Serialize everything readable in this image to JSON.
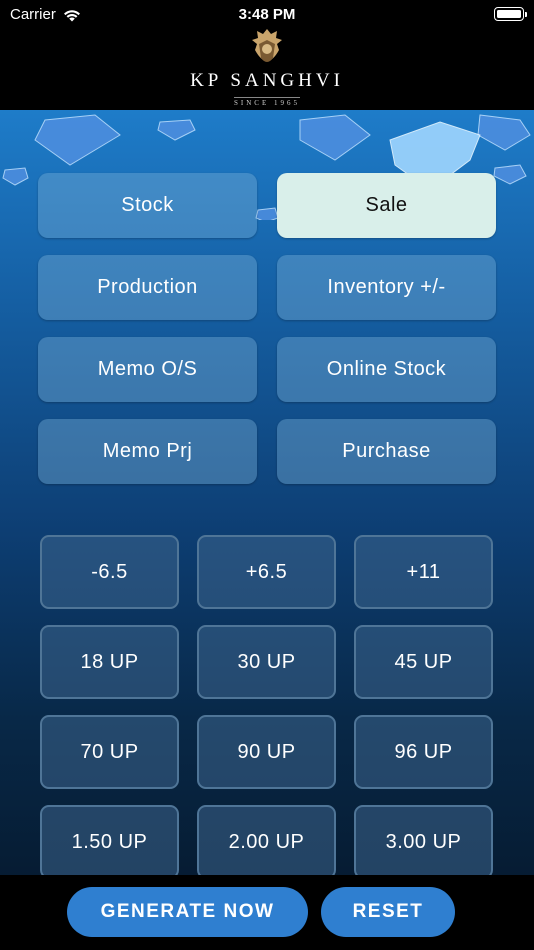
{
  "status_bar": {
    "carrier": "Carrier",
    "time": "3:48 PM"
  },
  "brand": {
    "name": "KP SANGHVI",
    "since": "SINCE 1965"
  },
  "nav_buttons": [
    {
      "label": "Stock",
      "active": false
    },
    {
      "label": "Sale",
      "active": true
    },
    {
      "label": "Production",
      "active": false
    },
    {
      "label": "Inventory +/-",
      "active": false
    },
    {
      "label": "Memo O/S",
      "active": false
    },
    {
      "label": "Online Stock",
      "active": false
    },
    {
      "label": "Memo Prj",
      "active": false
    },
    {
      "label": "Purchase",
      "active": false
    }
  ],
  "filter_chips": [
    "-6.5",
    "+6.5",
    "+11",
    "18 UP",
    "30 UP",
    "45 UP",
    "70 UP",
    "90 UP",
    "96 UP",
    "1.50 UP",
    "2.00 UP",
    "3.00 UP"
  ],
  "footer": {
    "generate_label": "GENERATE NOW",
    "reset_label": "RESET"
  },
  "colors": {
    "active_button": "#d9efea",
    "primary_button": "#2f7fd0"
  }
}
